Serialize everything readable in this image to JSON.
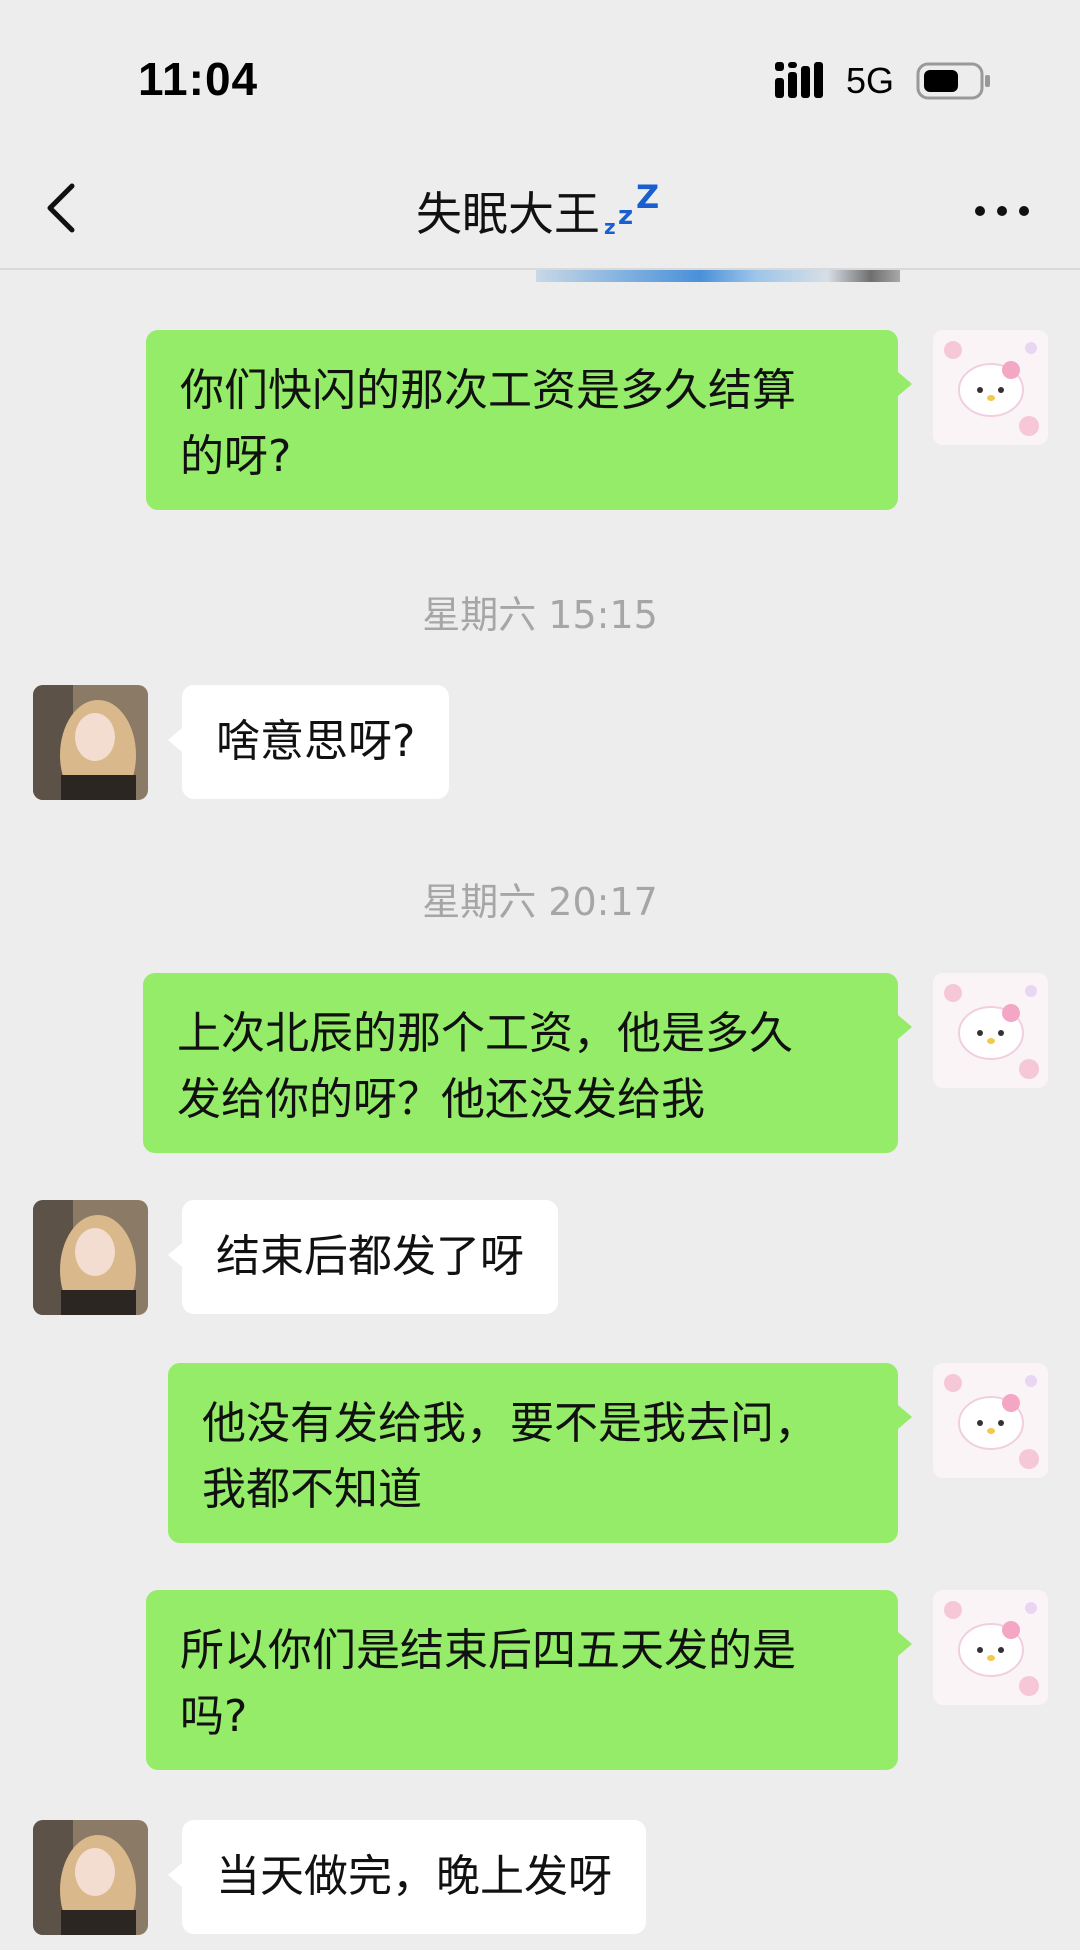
{
  "status_bar": {
    "time": "11:04",
    "network": "5G",
    "signal_icon": "signal-bars-icon",
    "battery_icon": "battery-icon"
  },
  "nav": {
    "back_icon": "chevron-left-icon",
    "title": "失眠大王",
    "title_emoji": "sleeping-zzz-icon",
    "more_icon": "more-dots-icon"
  },
  "colors": {
    "background": "#ededed",
    "self_bubble": "#95ec69",
    "other_bubble": "#ffffff",
    "timestamp_text": "#a6a6a6"
  },
  "messages": [
    {
      "sender": "self",
      "lines": [
        "你们快闪的那次工资是多久结算",
        "的呀?"
      ]
    },
    {
      "type": "timestamp",
      "text": "星期六 15:15"
    },
    {
      "sender": "other",
      "lines": [
        "啥意思呀?"
      ]
    },
    {
      "type": "timestamp",
      "text": "星期六 20:17"
    },
    {
      "sender": "self",
      "lines": [
        "上次北辰的那个工资，他是多久",
        "发给你的呀？他还没发给我"
      ]
    },
    {
      "sender": "other",
      "lines": [
        "结束后都发了呀"
      ]
    },
    {
      "sender": "self",
      "lines": [
        "他没有发给我，要不是我去问，",
        "我都不知道"
      ]
    },
    {
      "sender": "self",
      "lines": [
        "所以你们是结束后四五天发的是",
        "吗?"
      ]
    },
    {
      "sender": "other",
      "lines": [
        "当天做完，晚上发呀"
      ]
    }
  ]
}
